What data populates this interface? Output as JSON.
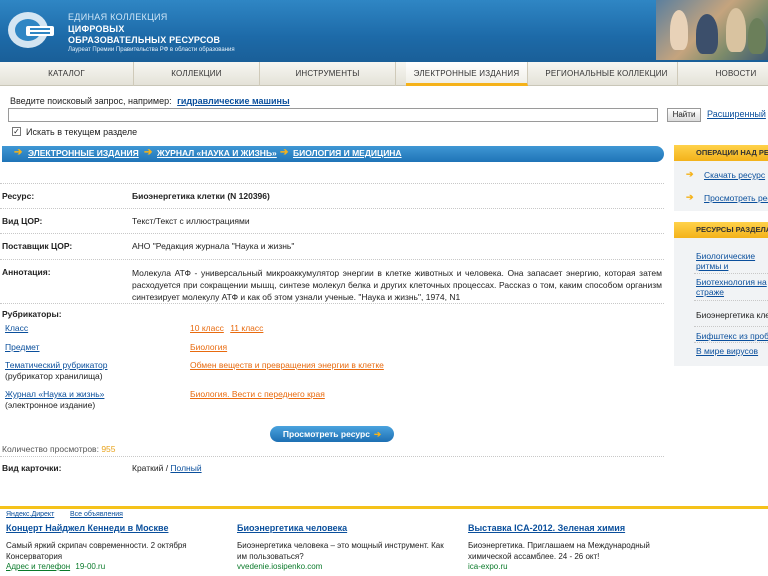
{
  "header": {
    "line1": "ЕДИНАЯ КОЛЛЕКЦИЯ",
    "line2": "ЦИФРОВЫХ",
    "line3": "ОБРАЗОВАТЕЛЬНЫХ РЕСУРСОВ",
    "line4": "Лауреат Премии Правительства РФ в области образования"
  },
  "nav": [
    "КАТАЛОГ",
    "КОЛЛЕКЦИИ",
    "ИНСТРУМЕНТЫ",
    "ЭЛЕКТРОННЫЕ ИЗДАНИЯ",
    "РЕГИОНАЛЬНЫЕ КОЛЛЕКЦИИ",
    "НОВОСТИ"
  ],
  "search": {
    "hint": "Введите поисковый запрос, например:",
    "example": "гидравлические машины",
    "value": "",
    "button": "Найти",
    "advanced": "Расширенный",
    "checkbox_label": "Искать в текущем разделе",
    "checkbox_checked": "✓"
  },
  "breadcrumb": [
    "ЭЛЕКТРОННЫЕ ИЗДАНИЯ",
    "ЖУРНАЛ «НАУКА И ЖИЗНЬ»",
    "БИОЛОГИЯ И МЕДИЦИНА"
  ],
  "resource": {
    "resource_label": "Ресурс:",
    "resource_value": "Биоэнергетика клетки (N 120396)",
    "type_label": "Вид ЦОР:",
    "type_value": "Текст/Текст с иллюстрациями",
    "supplier_label": "Поставщик ЦОР:",
    "supplier_value": "АНО \"Редакция журнала \"Наука и жизнь\"",
    "annotation_label": "Аннотация:",
    "annotation_value": "Молекула АТФ - универсальный микроаккумулятор энергии в клетке животных и человека. Она запасает энергию, которая затем расходуется при сокращении мышц, синтезе молекул белка и других клеточных процессах. Рассказ о том, каким способом организм синтезирует молекулу АТФ и как об этом узнали ученые. \"Наука и жизнь\", 1974, N1"
  },
  "rubricators": {
    "title": "Рубрикаторы:",
    "class_label": "Класс",
    "class_10": "10 класс",
    "class_11": "11 класс",
    "subject_label": "Предмет",
    "subject_value": "Биология",
    "thematic_label": "Тематический рубрикатор",
    "thematic_sub": "(рубрикатор хранилища)",
    "thematic_value": "Обмен веществ и превращения энергии в клетке",
    "journal_label": "Журнал «Наука и жизнь»",
    "journal_sub": "(электронное издание)",
    "journal_value": "Биология. Вести с переднего края"
  },
  "view_button": "Просмотреть ресурс",
  "views": {
    "label": "Количество просмотров:",
    "count": "955"
  },
  "card": {
    "label": "Вид карточки:",
    "brief": "Краткий",
    "sep": " / ",
    "full": "Полный"
  },
  "sidebar": {
    "ops_title": "ОПЕРАЦИИ НАД РЕСУРСОМ",
    "ops_links": [
      "Скачать ресурс",
      "Просмотреть ресурс"
    ],
    "section_title": "РЕСУРСЫ РАЗДЕЛА",
    "section_items": [
      "Биологические ритмы и приспособления",
      "Биотехнология на страже безопасности",
      "Биоэнергетика клетки",
      "Бифштекс из пробирки",
      "В мире вирусов"
    ]
  },
  "footer": {
    "direct": "Яндекс.Директ",
    "all_ads": "Все объявления",
    "ads": [
      {
        "title": "Концерт Найджел Кеннеди в Москве",
        "text": "Самый яркий скрипач современности. 2 октября Консерватория",
        "url": "Адрес и телефон",
        "url2": "19-00.ru"
      },
      {
        "title": "Биоэнергетика человека",
        "text": "Биоэнергетика человека – это мощный инструмент. Как им пользоваться?",
        "url": "vvedenie.iosipenko.com",
        "url2": ""
      },
      {
        "title": "Выставка ICA-2012. Зеленая химия",
        "text": "Биоэнергетика. Приглашаем на Международный химической ассамблее. 24 - 26 окт!",
        "url": "ica-expo.ru",
        "url2": ""
      }
    ]
  },
  "colors": {
    "accent": "#1d6fb3",
    "highlight": "#f5b21a",
    "link": "#0a4f9c",
    "orange_link": "#e86a0e"
  }
}
